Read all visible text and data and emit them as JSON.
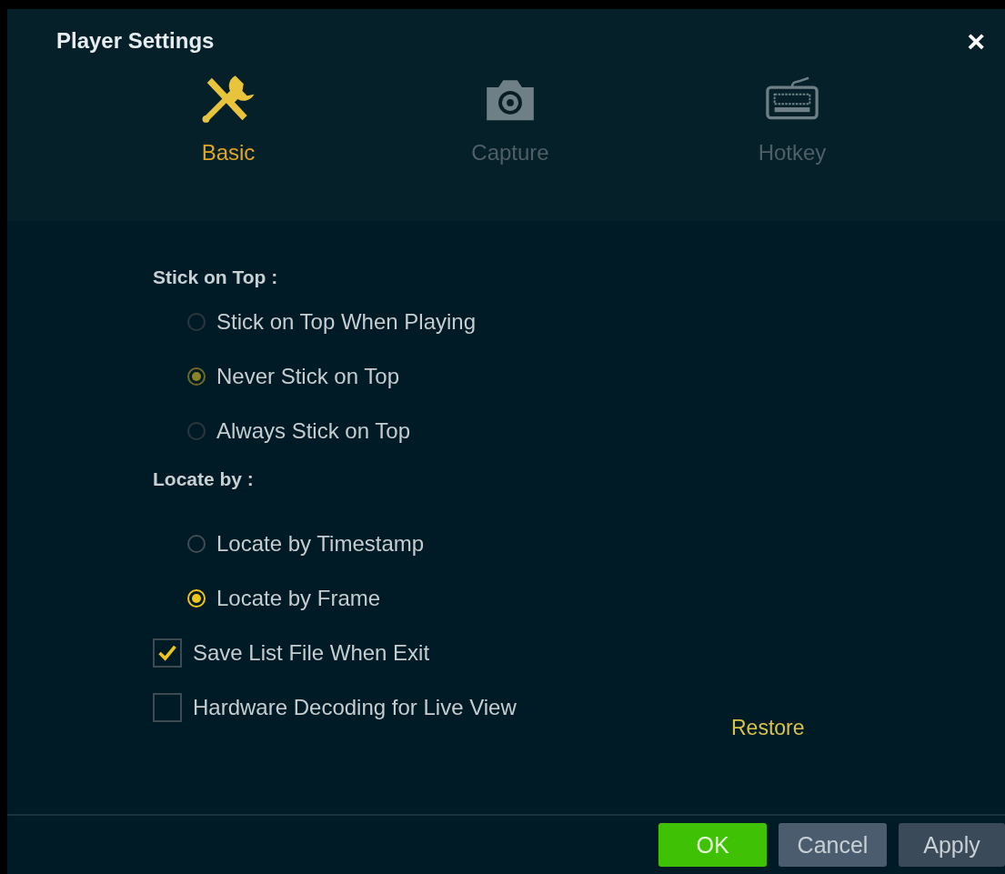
{
  "window": {
    "title": "Player Settings",
    "close": "×"
  },
  "tabs": [
    {
      "label": "Basic",
      "selected": true
    },
    {
      "label": "Capture",
      "selected": false
    },
    {
      "label": "Hotkey",
      "selected": false
    }
  ],
  "sections": [
    {
      "label": "Stick on Top :",
      "options": [
        {
          "label": "Stick on Top When Playing",
          "selected": false,
          "disabled": true
        },
        {
          "label": "Never Stick on Top",
          "selected": true,
          "disabled": true
        },
        {
          "label": "Always Stick on Top",
          "selected": false,
          "disabled": true
        }
      ]
    },
    {
      "label": "Locate by :",
      "options": [
        {
          "label": "Locate by Timestamp",
          "selected": false,
          "disabled": false
        },
        {
          "label": "Locate by Frame",
          "selected": true,
          "disabled": false
        }
      ]
    }
  ],
  "checkboxes": [
    {
      "label": "Save List File When Exit",
      "checked": true
    },
    {
      "label": "Hardware Decoding for Live View",
      "checked": false
    }
  ],
  "restore_link": "Restore",
  "buttons": [
    {
      "label": "OK",
      "kind": "primary"
    },
    {
      "label": "Cancel",
      "kind": "secondary"
    },
    {
      "label": "Apply",
      "kind": "secondary"
    }
  ]
}
